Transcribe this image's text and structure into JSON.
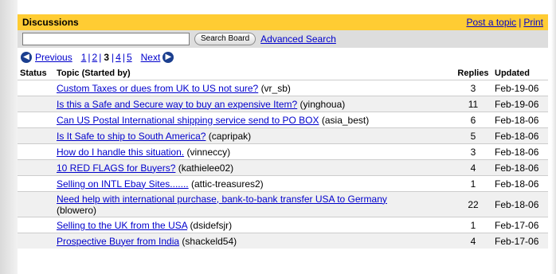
{
  "header": {
    "title": "Discussions",
    "post_label": "Post a topic",
    "print_label": "Print"
  },
  "search": {
    "value": "",
    "placeholder": "",
    "button_label": "Search Board",
    "advanced_label": "Advanced Search"
  },
  "pagination": {
    "previous_label": "Previous",
    "next_label": "Next",
    "current": "3",
    "pages_before": [
      "1",
      "2"
    ],
    "pages_after": [
      "4",
      "5"
    ]
  },
  "columns": {
    "status": "Status",
    "topic": "Topic (Started by)",
    "replies": "Replies",
    "updated": "Updated"
  },
  "rows": [
    {
      "title": "Custom Taxes or dues from UK to US not sure?",
      "author": "(vr_sb)",
      "replies": "3",
      "updated": "Feb-19-06"
    },
    {
      "title": "Is this a Safe and Secure way to buy an expensive Item?",
      "author": "(yinghoua)",
      "replies": "11",
      "updated": "Feb-19-06"
    },
    {
      "title": "Can US Postal International shipping service send to PO BOX",
      "author": "(asia_best)",
      "replies": "6",
      "updated": "Feb-18-06"
    },
    {
      "title": "Is It Safe to ship to South America?",
      "author": "(capripak)",
      "replies": "5",
      "updated": "Feb-18-06"
    },
    {
      "title": "How do I handle this situation.",
      "author": "(vinneccy)",
      "replies": "3",
      "updated": "Feb-18-06"
    },
    {
      "title": "10 RED FLAGS for Buyers?",
      "author": "(kathielee02)",
      "replies": "4",
      "updated": "Feb-18-06"
    },
    {
      "title": "Selling on INTL Ebay Sites.......",
      "author": "(attic-treasures2)",
      "replies": "1",
      "updated": "Feb-18-06"
    },
    {
      "title": "Need help with international purchase, bank-to-bank transfer USA to Germany",
      "author": "(blowero)",
      "replies": "22",
      "updated": "Feb-18-06"
    },
    {
      "title": "Selling to the UK from the USA",
      "author": "(dsidefsjr)",
      "replies": "1",
      "updated": "Feb-17-06"
    },
    {
      "title": "Prospective Buyer from India",
      "author": "(shackeld54)",
      "replies": "4",
      "updated": "Feb-17-06"
    }
  ],
  "colors": {
    "header_bg": "#ffcc33",
    "link": "#0000cc",
    "search_bg": "#dddddd",
    "row_alt": "#f0f0f0"
  },
  "icons": {
    "previous": "left-arrow-circle-icon",
    "next": "right-arrow-circle-icon"
  }
}
